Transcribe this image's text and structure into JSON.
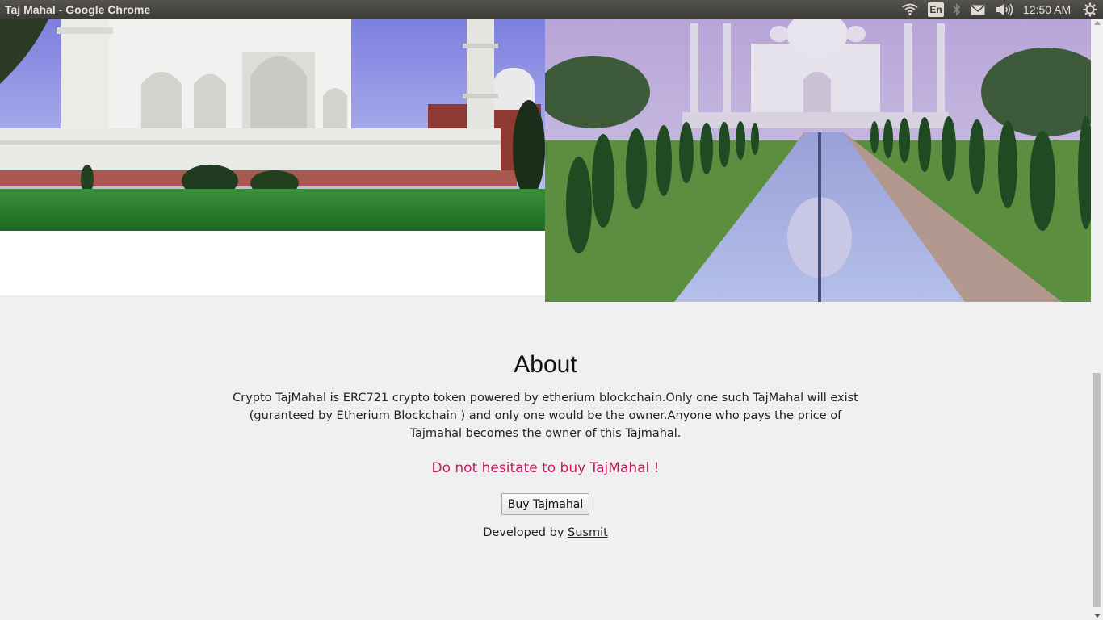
{
  "window": {
    "title": "Taj Mahal - Google Chrome"
  },
  "tray": {
    "keyboard_layout": "En",
    "clock": "12:50 AM",
    "icons": [
      "wifi-icon",
      "bluetooth-icon",
      "mail-icon",
      "volume-icon",
      "power-settings-icon"
    ]
  },
  "images": [
    {
      "name": "taj-mahal-side-view",
      "description_icon": "photo"
    },
    {
      "name": "taj-mahal-reflecting-pool",
      "description_icon": "photo"
    }
  ],
  "about": {
    "title": "About",
    "description": "Crypto TajMahal is ERC721 crypto token powered by etherium blockchain.Only one such TajMahal will exist (guranteed by Etherium Blockchain ) and only one would be the owner.Anyone who pays the price of Tajmahal becomes the owner of this Tajmahal.",
    "cta": "Do not hesitate to buy TajMahal !",
    "buy_button": "Buy Tajmahal",
    "credit_prefix": "Developed by ",
    "credit_link": "Susmit"
  },
  "colors": {
    "cta": "#c7195f",
    "page_background": "#f0f0f0",
    "topbar": "#3c3b37"
  }
}
